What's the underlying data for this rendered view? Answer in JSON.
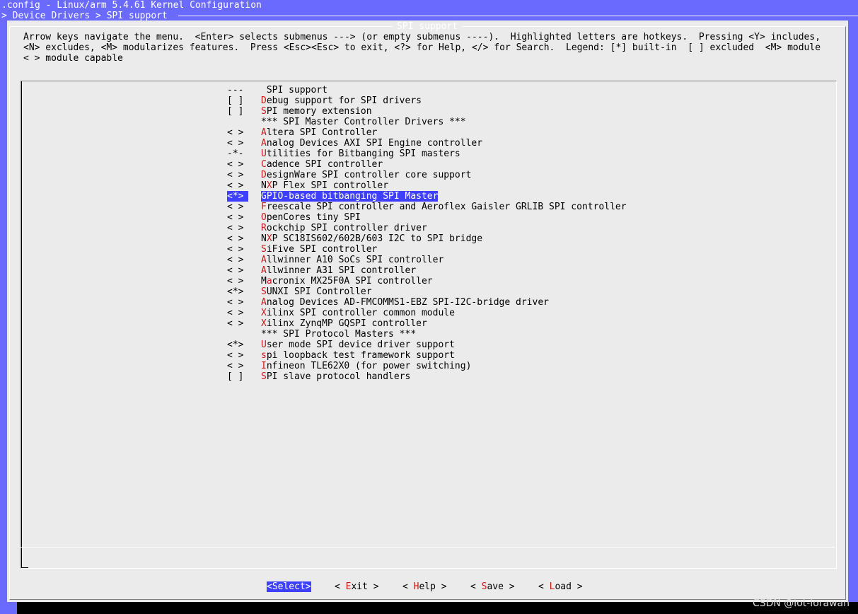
{
  "window": {
    "title": ".config - Linux/arm 5.4.61 Kernel Configuration",
    "breadcrumb": "> Device Drivers > SPI support"
  },
  "dialog": {
    "title": "SPI support",
    "help_lines": [
      "Arrow keys navigate the menu.  <Enter> selects submenus ---> (or empty submenus ----).  Highlighted letters are hotkeys.  Pressing <Y> includes,",
      "<N> excludes, <M> modularizes features.  Press <Esc><Esc> to exit, <?> for Help, </> for Search.  Legend: [*] built-in  [ ] excluded  <M> module",
      "< > module capable"
    ]
  },
  "menu": {
    "selected_index": 10,
    "items": [
      {
        "mark": "---",
        "hot": "",
        "rest": " SPI support",
        "kind": "header"
      },
      {
        "mark": "[ ]",
        "hot": "D",
        "rest": "ebug support for SPI drivers"
      },
      {
        "mark": "[ ]",
        "hot": "S",
        "rest": "PI memory extension"
      },
      {
        "mark": "",
        "hot": "",
        "rest": "*** SPI Master Controller Drivers ***",
        "kind": "comment"
      },
      {
        "mark": "< >",
        "hot": "A",
        "rest": "ltera SPI Controller"
      },
      {
        "mark": "< >",
        "hot": "A",
        "rest": "nalog Devices AXI SPI Engine controller"
      },
      {
        "mark": "-*-",
        "hot": "U",
        "rest": "tilities for Bitbanging SPI masters"
      },
      {
        "mark": "< >",
        "hot": "C",
        "rest": "adence SPI controller"
      },
      {
        "mark": "< >",
        "hot": "D",
        "rest": "esignWare SPI controller core support"
      },
      {
        "mark": "< >",
        "pre": "N",
        "hot": "X",
        "rest": "P Flex SPI controller"
      },
      {
        "mark": "<*>",
        "hot": "G",
        "rest": "PIO-based bitbanging SPI Master"
      },
      {
        "mark": "< >",
        "hot": "F",
        "rest": "reescale SPI controller and Aeroflex Gaisler GRLIB SPI controller"
      },
      {
        "mark": "< >",
        "hot": "O",
        "rest": "penCores tiny SPI"
      },
      {
        "mark": "< >",
        "hot": "R",
        "rest": "ockchip SPI controller driver"
      },
      {
        "mark": "< >",
        "pre": "N",
        "hot": "X",
        "rest": "P SC18IS602/602B/603 I2C to SPI bridge"
      },
      {
        "mark": "< >",
        "hot": "S",
        "rest": "iFive SPI controller"
      },
      {
        "mark": "< >",
        "hot": "A",
        "rest": "llwinner A10 SoCs SPI controller"
      },
      {
        "mark": "< >",
        "hot": "A",
        "rest": "llwinner A31 SPI controller"
      },
      {
        "mark": "< >",
        "pre": "M",
        "hot": "a",
        "rest": "cronix MX25F0A SPI controller"
      },
      {
        "mark": "<*>",
        "hot": "S",
        "rest": "UNXI SPI Controller"
      },
      {
        "mark": "< >",
        "hot": "A",
        "rest": "nalog Devices AD-FMCOMMS1-EBZ SPI-I2C-bridge driver"
      },
      {
        "mark": "< >",
        "hot": "X",
        "rest": "ilinx SPI controller common module"
      },
      {
        "mark": "< >",
        "hot": "X",
        "rest": "ilinx ZynqMP GQSPI controller"
      },
      {
        "mark": "",
        "hot": "",
        "rest": "*** SPI Protocol Masters ***",
        "kind": "comment"
      },
      {
        "mark": "<*>",
        "hot": "U",
        "rest": "ser mode SPI device driver support"
      },
      {
        "mark": "< >",
        "hot": "s",
        "rest": "pi loopback test framework support"
      },
      {
        "mark": "< >",
        "hot": "I",
        "rest": "nfineon TLE62X0 (for power switching)"
      },
      {
        "mark": "[ ]",
        "hot": "S",
        "rest": "PI slave protocol handlers"
      }
    ]
  },
  "buttons": [
    {
      "label": "<Select>",
      "pre": "<",
      "hot": "",
      "post": "",
      "selected": true
    },
    {
      "label": "< Exit >",
      "pre": "< ",
      "hot": "E",
      "post": "xit >"
    },
    {
      "label": "< Help >",
      "pre": "< ",
      "hot": "H",
      "post": "elp >"
    },
    {
      "label": "< Save >",
      "pre": "< ",
      "hot": "S",
      "post": "ave >"
    },
    {
      "label": "< Load >",
      "pre": "< ",
      "hot": "L",
      "post": "oad >"
    }
  ],
  "watermark": "CSDN @iot-lorawan",
  "colors": {
    "background": "#6a6aff",
    "dialog": "#ebebeb",
    "highlight": "#3f3fff",
    "hotkey": "#c81a1a"
  }
}
